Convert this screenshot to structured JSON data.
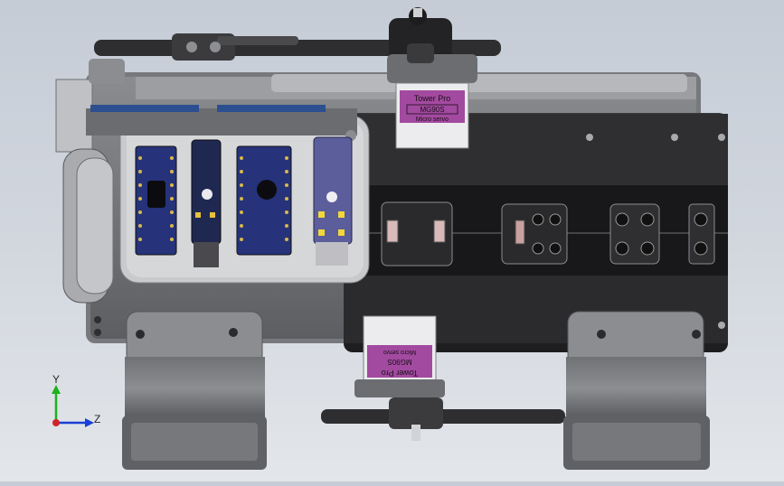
{
  "viewport": {
    "background_top": "#c5ccd6",
    "background_bottom": "#e3e6ea"
  },
  "colors": {
    "chassis_dark": "#2b2b2d",
    "chassis_mid": "#6d6f73",
    "chassis_light": "#a9abb0",
    "plate": "#c9cacc",
    "pcb_blue": "#26337a",
    "module_purple": "#5b5e9a",
    "servo_label": "#a24a9f",
    "servo_body": "#e9e9ea",
    "axis_y": "#1db11d",
    "axis_z": "#1a3fd6",
    "axis_origin": "#d0242a"
  },
  "servo_top": {
    "line1": "Tower Pro",
    "line2": "MG90S",
    "line3": "Micro servo"
  },
  "servo_bottom": {
    "line1": "Tower Pro",
    "line2": "MG90S",
    "line3": "Micro servo"
  },
  "triad": {
    "y_label": "Y",
    "z_label": "Z",
    "icon": "coordinate-axes-icon"
  }
}
